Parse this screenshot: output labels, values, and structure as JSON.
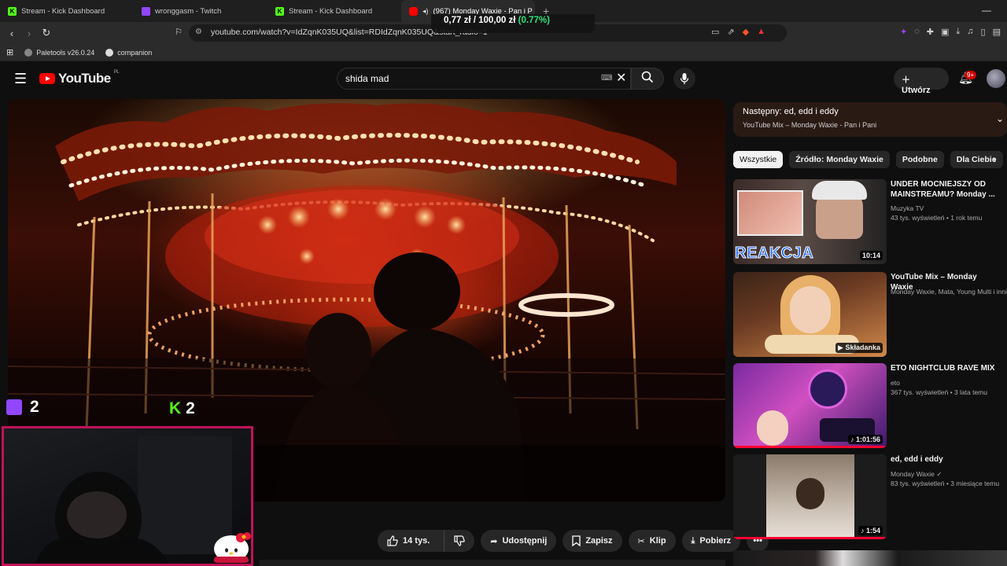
{
  "browser": {
    "tabs": [
      {
        "label": "Stream - Kick Dashboard",
        "icon": "kick-icon"
      },
      {
        "label": "wronggasm - Twitch",
        "icon": "twitch-icon"
      },
      {
        "label": "Stream - Kick Dashboard",
        "icon": "kick-icon"
      },
      {
        "label": "(967) Monday Waxie - Pan i P",
        "icon": "youtube-icon",
        "active": true
      }
    ],
    "url": "youtube.com/watch?v=IdZqnK035UQ&list=RDIdZqnK035UQ&start_radio=1",
    "bookmarks": [
      {
        "label": "Paletools v26.0.24"
      },
      {
        "label": "companion"
      }
    ],
    "price_overlay": {
      "value": "0,77 zł",
      "target": "/ 100,00 zł",
      "pct": "(0.77%)"
    }
  },
  "youtube": {
    "logo_text": "YouTube",
    "region": "PL",
    "search_value": "shida mad",
    "create_label": "Utwórz",
    "notif_badge": "9+"
  },
  "overlay": {
    "twitch_viewers": "2",
    "kick_viewers": "2"
  },
  "actions": {
    "like_count": "14 tys.",
    "share": "Udostępnij",
    "save": "Zapisz",
    "clip": "Klip",
    "download": "Pobierz"
  },
  "sidebar": {
    "next": {
      "title": "Następny: ed, edd i eddy",
      "subtitle": "YouTube Mix – Monday Waxie - Pan i Pani"
    },
    "chips": [
      "Wszystkie",
      "Źródło: Monday Waxie",
      "Podobne",
      "Dla Ciebie"
    ],
    "items": [
      {
        "title": "UNDER MOCNIEJSZY OD MAINSTREAMU? Monday ...",
        "channel": "Muzyka TV",
        "meta": "43 tys. wyświetleń • 1 rok temu",
        "duration": "10:14",
        "thumb_text": "REAKCJA"
      },
      {
        "title": "YouTube Mix – Monday Waxie",
        "channel": "Monday Waxie, Mata, Young Multi i inni",
        "meta": "",
        "duration": "Składanka"
      },
      {
        "title": "ETO NIGHTCLUB RAVE MIX",
        "channel": "eto",
        "meta": "367 tys. wyświetleń • 3 lata temu",
        "duration": "1:01:56"
      },
      {
        "title": "ed, edd i eddy",
        "channel": "Monday Waxie",
        "meta": "83 tys. wyświetleń • 3 miesiące temu",
        "duration": "1:54"
      }
    ]
  },
  "colors": {
    "accent": "#ff0000",
    "kick": "#53fc18",
    "twitch": "#9146ff",
    "webcam_border": "#c0125a"
  }
}
